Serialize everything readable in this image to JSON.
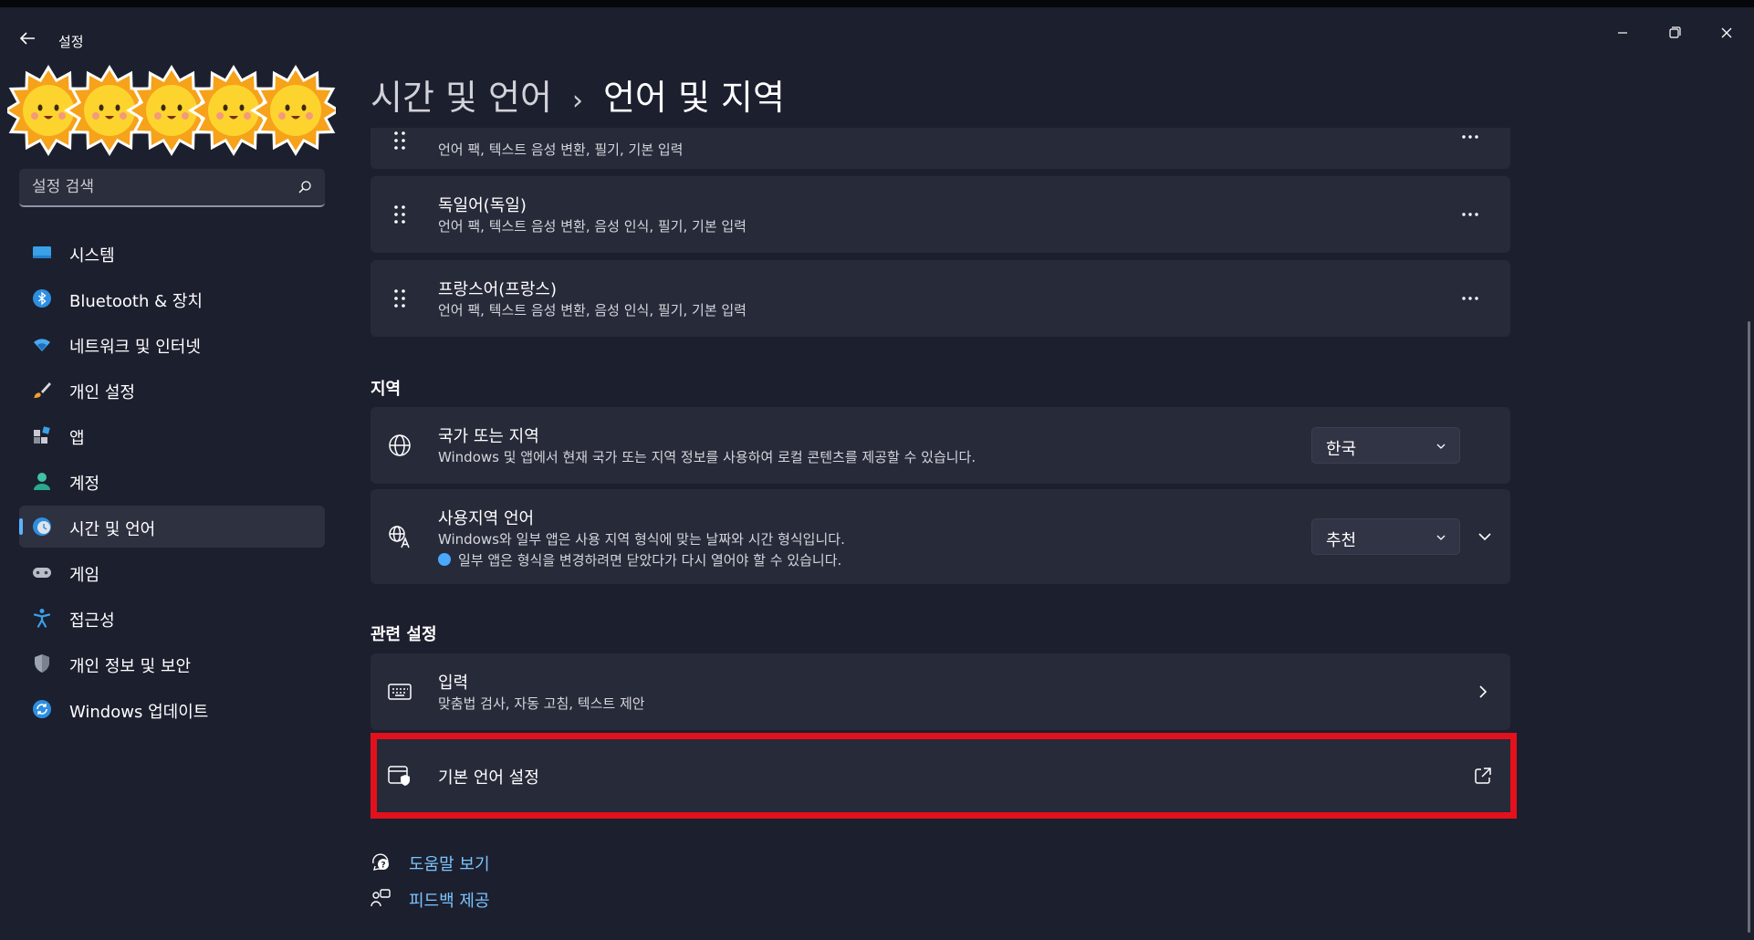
{
  "window": {
    "app_title": "설정"
  },
  "search": {
    "placeholder": "설정 검색"
  },
  "sidebar": {
    "items": [
      {
        "label": "시스템",
        "icon": "system-icon"
      },
      {
        "label": "Bluetooth & 장치",
        "icon": "bluetooth-icon"
      },
      {
        "label": "네트워크 및 인터넷",
        "icon": "wifi-icon"
      },
      {
        "label": "개인 설정",
        "icon": "brush-icon"
      },
      {
        "label": "앱",
        "icon": "apps-icon"
      },
      {
        "label": "계정",
        "icon": "account-icon"
      },
      {
        "label": "시간 및 언어",
        "icon": "time-language-icon",
        "active": true
      },
      {
        "label": "게임",
        "icon": "gamepad-icon"
      },
      {
        "label": "접근성",
        "icon": "accessibility-icon"
      },
      {
        "label": "개인 정보 및 보안",
        "icon": "shield-icon"
      },
      {
        "label": "Windows 업데이트",
        "icon": "update-icon"
      }
    ]
  },
  "header": {
    "breadcrumb_parent": "시간 및 언어",
    "breadcrumb_separator": "›",
    "breadcrumb_current": "언어 및 지역"
  },
  "languages": [
    {
      "subtitle": "언어 팩, 텍스트 음성 변환, 필기, 기본 입력"
    },
    {
      "title": "독일어(독일)",
      "subtitle": "언어 팩, 텍스트 음성 변환, 음성 인식, 필기, 기본 입력"
    },
    {
      "title": "프랑스어(프랑스)",
      "subtitle": "언어 팩, 텍스트 음성 변환, 음성 인식, 필기, 기본 입력"
    }
  ],
  "region": {
    "section_title": "지역",
    "country": {
      "title": "국가 또는 지역",
      "subtitle": "Windows 및 앱에서 현재 국가 또는 지역 정보를 사용하여 로컬 콘텐츠를 제공할 수 있습니다.",
      "value": "한국"
    },
    "format": {
      "title": "사용지역 언어",
      "subtitle": "Windows와 일부 앱은 사용 지역 형식에 맞는 날짜와 시간 형식입니다.",
      "note": "일부 앱은 형식을 변경하려면 닫았다가 다시 열어야 할 수 있습니다.",
      "value": "추천"
    }
  },
  "related": {
    "section_title": "관련 설정",
    "typing": {
      "title": "입력",
      "subtitle": "맞춤법 검사, 자동 고침, 텍스트 제안"
    },
    "admin_language": {
      "title": "기본 언어 설정"
    }
  },
  "footer": {
    "help": "도움말 보기",
    "feedback": "피드백 제공"
  },
  "colors": {
    "background": "#1c1f2e",
    "card": "#272a39",
    "accent": "#5ab3ff",
    "link": "#7cc4ff",
    "highlight": "#e3111c"
  }
}
